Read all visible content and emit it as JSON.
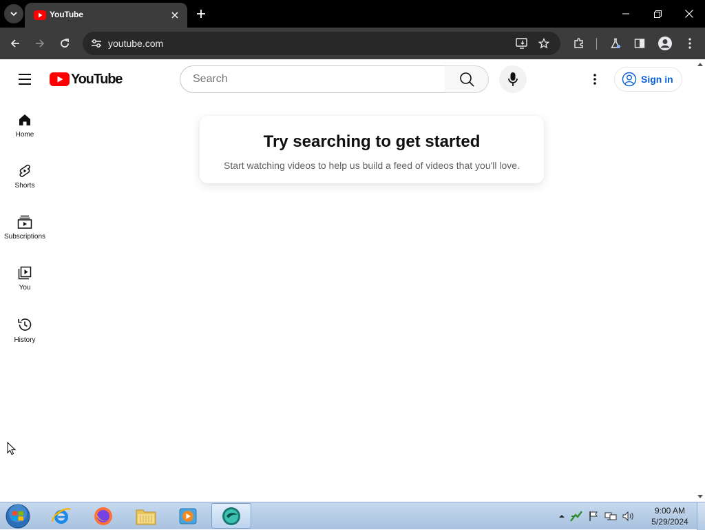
{
  "browser": {
    "tab": {
      "title": "YouTube",
      "favicon": "youtube-favicon-icon"
    },
    "omnibox": {
      "url": "youtube.com"
    },
    "colors": {
      "titlebar": "#000000",
      "toolbar": "#3c3c3c",
      "omnibox": "#282828"
    }
  },
  "youtube": {
    "logo": {
      "wordmark": "YouTube",
      "brand_color": "#ff0000"
    },
    "search": {
      "placeholder": "Search",
      "value": ""
    },
    "signin_label": "Sign in",
    "guide": [
      {
        "label": "Home",
        "icon": "home-icon"
      },
      {
        "label": "Shorts",
        "icon": "shorts-icon"
      },
      {
        "label": "Subscriptions",
        "icon": "subscriptions-icon"
      },
      {
        "label": "You",
        "icon": "you-icon"
      },
      {
        "label": "History",
        "icon": "history-icon"
      }
    ],
    "empty_state": {
      "title": "Try searching to get started",
      "subtitle": "Start watching videos to help us build a feed of videos that you'll love."
    },
    "colors": {
      "link": "#065fd4",
      "text": "#0f0f0f",
      "secondary_text": "#606060"
    }
  },
  "taskbar": {
    "apps": [
      "internet-explorer-icon",
      "firefox-icon",
      "file-explorer-icon",
      "media-player-icon",
      "active-app-icon"
    ],
    "clock": {
      "time": "9:00 AM",
      "date": "5/29/2024"
    }
  }
}
